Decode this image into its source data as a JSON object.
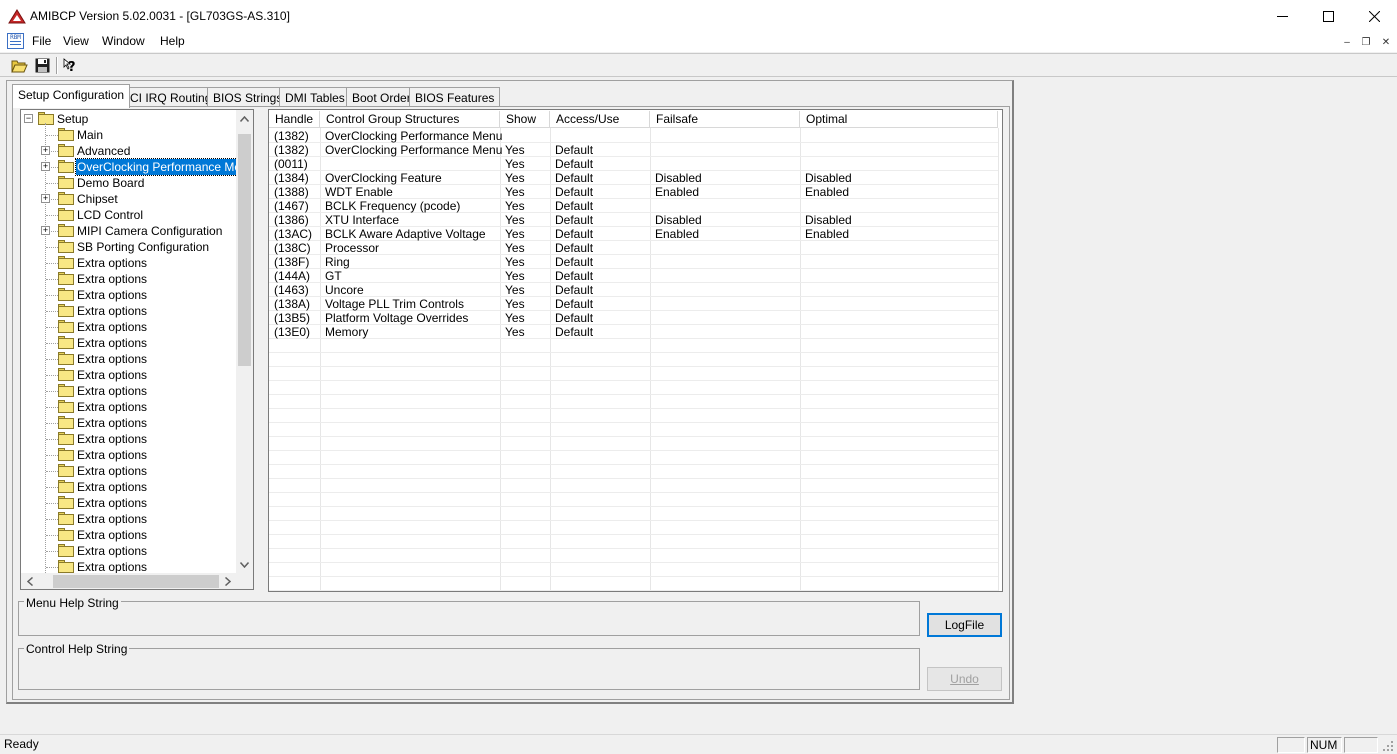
{
  "window": {
    "title": "AMIBCP Version 5.02.0031 - [GL703GS-AS.310]",
    "minimize": "—",
    "maximize": "☐",
    "close": "✕"
  },
  "menu": {
    "icon_text": "RBM",
    "items": [
      "File",
      "View",
      "Window",
      "Help"
    ],
    "mdi_minimize": "–",
    "mdi_restore": "❐",
    "mdi_close": "✕"
  },
  "toolbar": {
    "open_icon": "folder-open-icon",
    "save_icon": "floppy-disk-icon",
    "help_icon": "context-help-icon"
  },
  "tabs": [
    "Setup Configuration",
    "PCI IRQ Routing",
    "BIOS Strings",
    "DMI Tables",
    "Boot Order",
    "BIOS Features"
  ],
  "active_tab": "Setup Configuration",
  "tree": {
    "root": "Setup",
    "items": [
      {
        "label": "Main",
        "expandable": false,
        "selected": false
      },
      {
        "label": "Advanced",
        "expandable": true,
        "selected": false
      },
      {
        "label": "OverClocking Performance Menu",
        "expandable": true,
        "selected": true
      },
      {
        "label": "Demo Board",
        "expandable": false,
        "selected": false
      },
      {
        "label": "Chipset",
        "expandable": true,
        "selected": false
      },
      {
        "label": "LCD Control",
        "expandable": false,
        "selected": false
      },
      {
        "label": "MIPI Camera Configuration",
        "expandable": true,
        "selected": false
      },
      {
        "label": "SB Porting Configuration",
        "expandable": false,
        "selected": false
      },
      {
        "label": "Extra options",
        "expandable": false,
        "selected": false
      },
      {
        "label": "Extra options",
        "expandable": false,
        "selected": false
      },
      {
        "label": "Extra options",
        "expandable": false,
        "selected": false
      },
      {
        "label": "Extra options",
        "expandable": false,
        "selected": false
      },
      {
        "label": "Extra options",
        "expandable": false,
        "selected": false
      },
      {
        "label": "Extra options",
        "expandable": false,
        "selected": false
      },
      {
        "label": "Extra options",
        "expandable": false,
        "selected": false
      },
      {
        "label": "Extra options",
        "expandable": false,
        "selected": false
      },
      {
        "label": "Extra options",
        "expandable": false,
        "selected": false
      },
      {
        "label": "Extra options",
        "expandable": false,
        "selected": false
      },
      {
        "label": "Extra options",
        "expandable": false,
        "selected": false
      },
      {
        "label": "Extra options",
        "expandable": false,
        "selected": false
      },
      {
        "label": "Extra options",
        "expandable": false,
        "selected": false
      },
      {
        "label": "Extra options",
        "expandable": false,
        "selected": false
      },
      {
        "label": "Extra options",
        "expandable": false,
        "selected": false
      },
      {
        "label": "Extra options",
        "expandable": false,
        "selected": false
      },
      {
        "label": "Extra options",
        "expandable": false,
        "selected": false
      },
      {
        "label": "Extra options",
        "expandable": false,
        "selected": false
      },
      {
        "label": "Extra options",
        "expandable": false,
        "selected": false
      },
      {
        "label": "Extra options",
        "expandable": false,
        "selected": false
      },
      {
        "label": "Extra options",
        "expandable": false,
        "selected": false
      }
    ]
  },
  "grid": {
    "columns": [
      "Handle",
      "Control Group Structures",
      "Show",
      "Access/Use",
      "Failsafe",
      "Optimal"
    ],
    "rows": [
      [
        "(1382)",
        "OverClocking Performance Menu",
        "",
        "",
        "",
        ""
      ],
      [
        "(1382)",
        "OverClocking Performance Menu",
        "Yes",
        "Default",
        "",
        ""
      ],
      [
        "(0011)",
        "",
        "Yes",
        "Default",
        "",
        ""
      ],
      [
        "(1384)",
        "OverClocking Feature",
        "Yes",
        "Default",
        "Disabled",
        "Disabled"
      ],
      [
        "(1388)",
        "WDT Enable",
        "Yes",
        "Default",
        "Enabled",
        "Enabled"
      ],
      [
        "(1467)",
        "BCLK Frequency (pcode)",
        "Yes",
        "Default",
        "",
        ""
      ],
      [
        "(1386)",
        "XTU Interface",
        "Yes",
        "Default",
        "Disabled",
        "Disabled"
      ],
      [
        "(13AC)",
        "BCLK Aware Adaptive Voltage",
        "Yes",
        "Default",
        "Enabled",
        "Enabled"
      ],
      [
        "(138C)",
        "Processor",
        "Yes",
        "Default",
        "",
        ""
      ],
      [
        "(138F)",
        "Ring",
        "Yes",
        "Default",
        "",
        ""
      ],
      [
        "(144A)",
        "GT",
        "Yes",
        "Default",
        "",
        ""
      ],
      [
        "(1463)",
        "Uncore",
        "Yes",
        "Default",
        "",
        ""
      ],
      [
        "(138A)",
        "Voltage PLL Trim Controls",
        "Yes",
        "Default",
        "",
        ""
      ],
      [
        "(13B5)",
        "Platform Voltage Overrides",
        "Yes",
        "Default",
        "",
        ""
      ],
      [
        "(13E0)",
        "Memory",
        "Yes",
        "Default",
        "",
        ""
      ]
    ]
  },
  "groups": {
    "menu_help_label": "Menu Help String",
    "menu_help_value": "",
    "control_help_label": "Control Help String",
    "control_help_value": ""
  },
  "buttons": {
    "logfile": "LogFile",
    "undo": "Undo"
  },
  "status": {
    "text": "Ready",
    "num": "NUM"
  },
  "colors": {
    "selection": "#0078d7",
    "folder": "#f8e784"
  }
}
